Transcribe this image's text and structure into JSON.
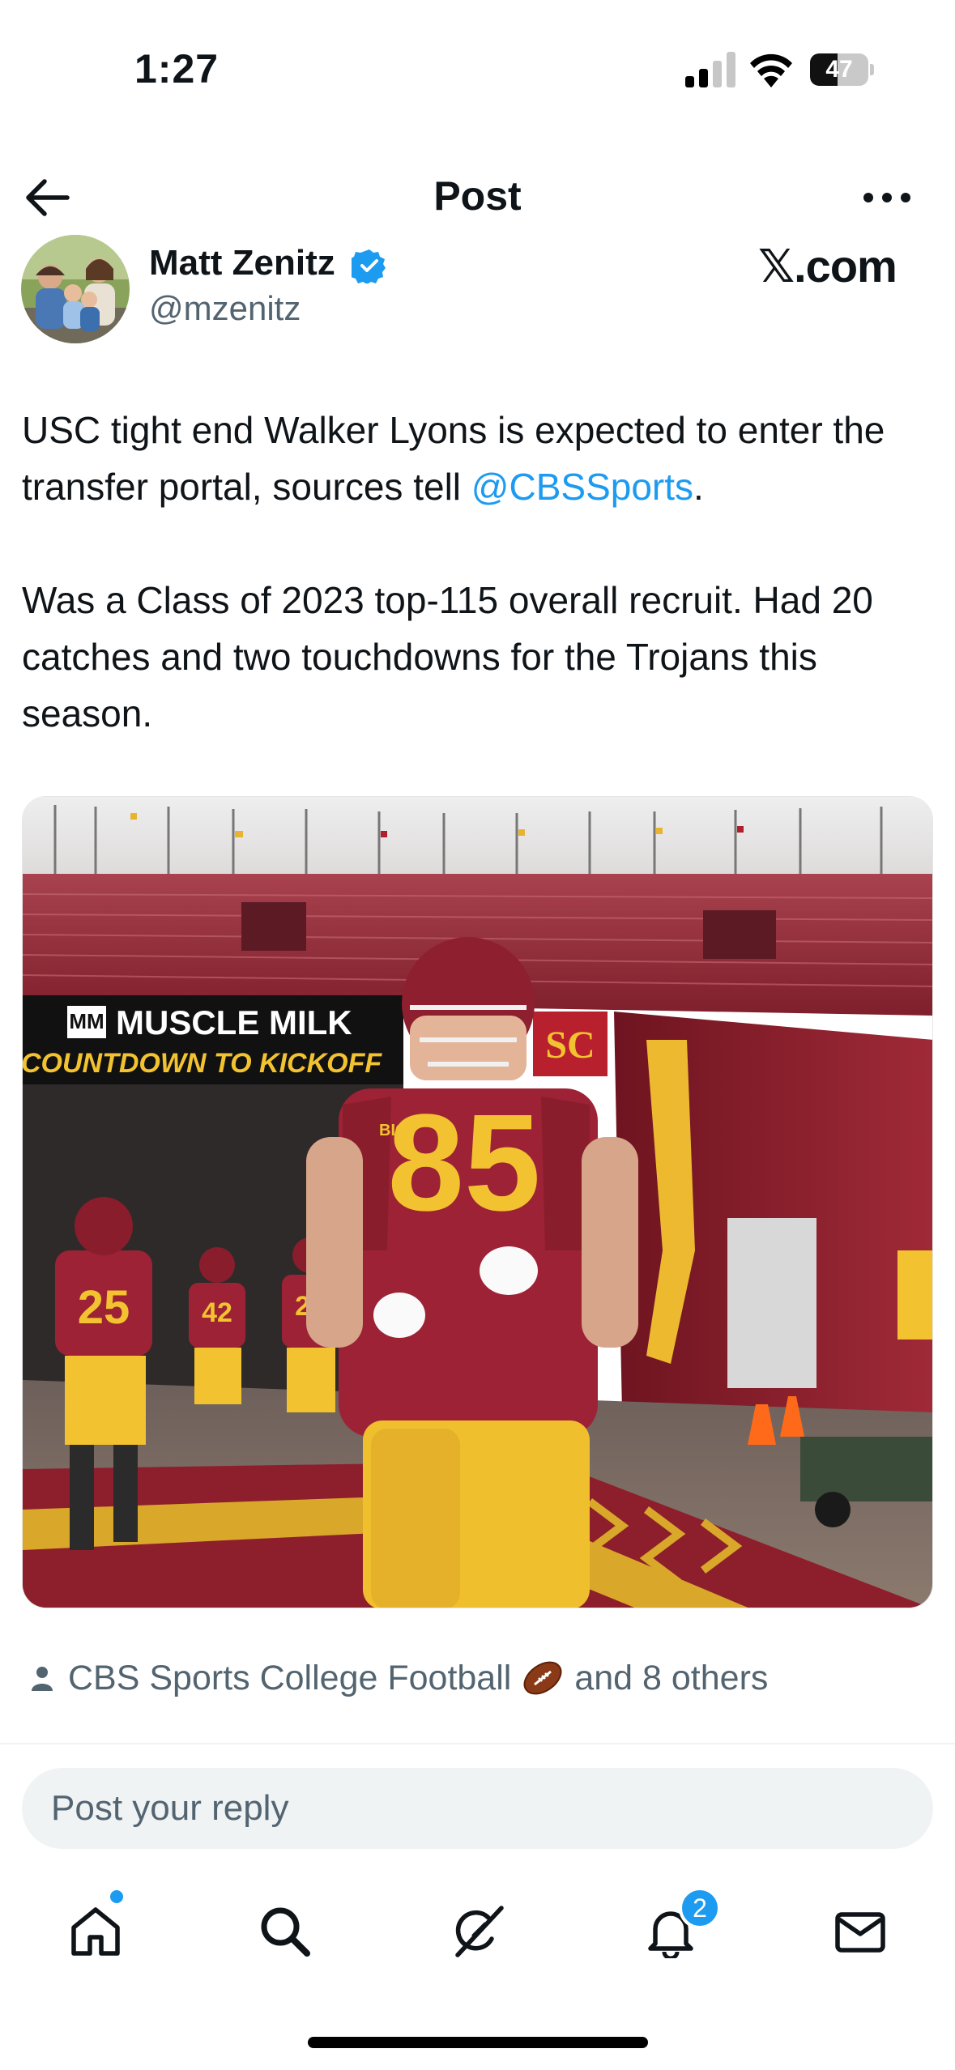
{
  "status_bar": {
    "time": "1:27",
    "battery_level": "47",
    "battery_fraction": 0.47
  },
  "header": {
    "title": "Post"
  },
  "author": {
    "name": "Matt Zenitz",
    "handle": "@mzenitz",
    "verified": true
  },
  "watermark": "𝕏.com",
  "post": {
    "paragraph1_before": "USC tight end Walker Lyons is expected to enter the transfer portal, sources tell ",
    "mention": "@CBSSports",
    "paragraph1_after": ".",
    "paragraph2": "Was a Class of 2023 top-115 overall recruit. Had 20 catches and two touchdowns for the Trojans this season.",
    "image_signage": {
      "sponsor": "MUSCLE MILK",
      "countdown": "COUNTDOWN TO KICKOFF",
      "jersey_main": "85",
      "jersey_left": "25",
      "jersey_mid": "42",
      "jersey_back": "24",
      "conference": "BIG",
      "monogram": "SC"
    }
  },
  "tagged": {
    "primary": "CBS Sports College Football",
    "emoji": "american-football-emoji",
    "suffix": "and 8 others"
  },
  "reply": {
    "placeholder": "Post your reply"
  },
  "tabbar": {
    "items": [
      "home-icon",
      "search-icon",
      "grok-icon",
      "notifications-icon",
      "messages-icon"
    ],
    "notification_count": "2"
  },
  "colors": {
    "accent": "#1d9bf0",
    "text": "#0f1419",
    "muted": "#536471",
    "cardinal": "#9d2235",
    "gold": "#f2c230"
  }
}
